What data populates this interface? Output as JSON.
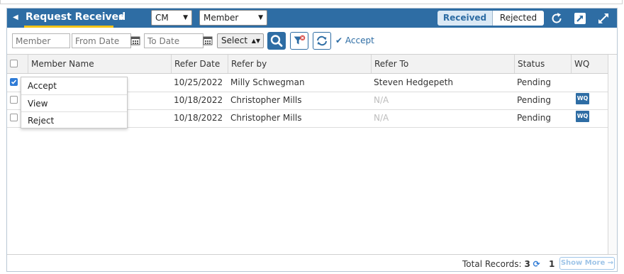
{
  "header": {
    "title": "Request Received",
    "prev_icon": "caret-left-icon",
    "next_icon": "caret-right-icon",
    "program_select": "CM",
    "member_type_select": "Member",
    "tabs": [
      {
        "label": "Received",
        "active": true
      },
      {
        "label": "Rejected",
        "active": false
      }
    ],
    "icons": [
      "refresh-icon",
      "popout-icon",
      "expand-icon"
    ]
  },
  "toolbar": {
    "member_placeholder": "Member",
    "from_date_placeholder": "From Date",
    "to_date_placeholder": "To Date",
    "select_value": "Select",
    "accept_label": "Accept"
  },
  "table": {
    "columns": [
      "Member Name",
      "Refer Date",
      "Refer by",
      "Refer To",
      "Status",
      "WQ"
    ],
    "rows": [
      {
        "checked": true,
        "member_name": "",
        "refer_date": "10/25/2022",
        "refer_by": "Milly Schwegman",
        "refer_to": "Steven Hedgepeth",
        "status": "Pending",
        "wq": ""
      },
      {
        "checked": false,
        "member_name": "",
        "refer_date": "10/18/2022",
        "refer_by": "Christopher Mills",
        "refer_to": "N/A",
        "status": "Pending",
        "wq": "WQ"
      },
      {
        "checked": false,
        "member_name": "",
        "refer_date": "10/18/2022",
        "refer_by": "Christopher Mills",
        "refer_to": "N/A",
        "status": "Pending",
        "wq": "WQ"
      }
    ]
  },
  "context_menu": {
    "items": [
      "Accept",
      "View",
      "Reject"
    ]
  },
  "footer": {
    "total_label": "Total Records:",
    "total_value": "3",
    "page": "1",
    "show_more": "Show More"
  },
  "colors": {
    "header_bg": "#2e6da4",
    "title_underline": "#f3c316",
    "accent": "#2e6da4"
  }
}
